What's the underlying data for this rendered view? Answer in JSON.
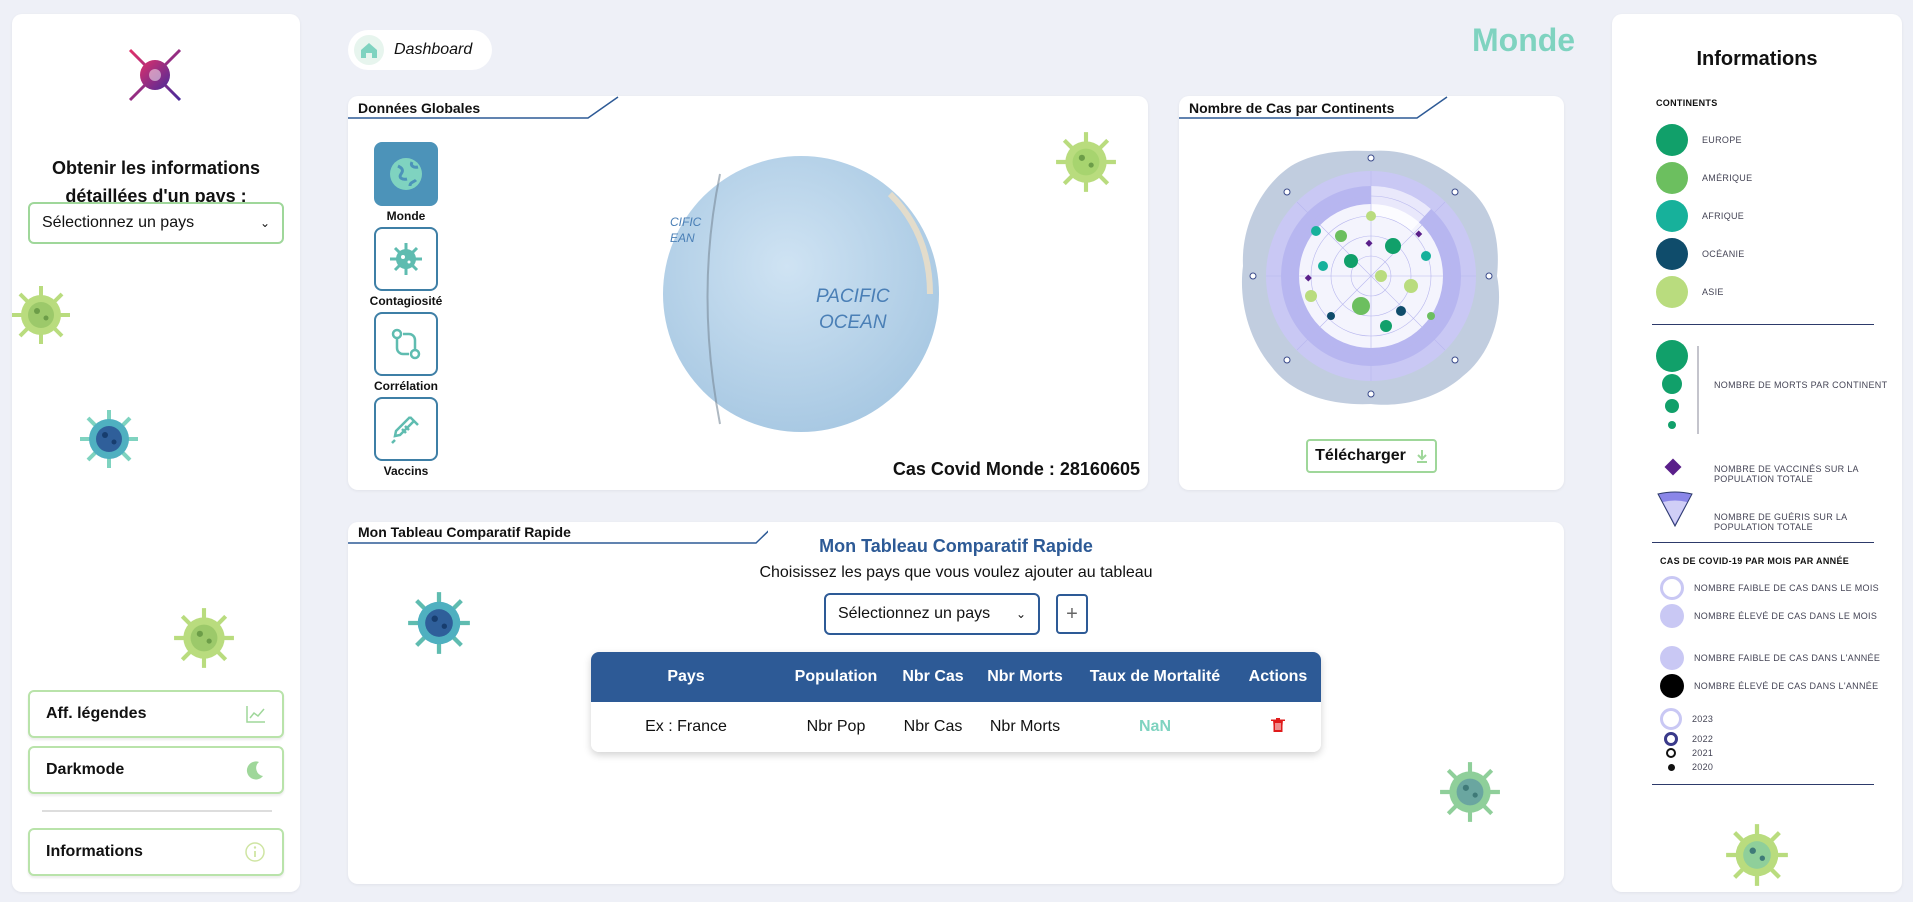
{
  "sidebar": {
    "prompt_line1": "Obtenir les informations",
    "prompt_line2": "détaillées d'un pays :",
    "country_select": "Sélectionnez un pays",
    "buttons": [
      {
        "label": "Aff. légendes",
        "icon": "chart-line-icon"
      },
      {
        "label": "Darkmode",
        "icon": "moon-icon"
      },
      {
        "label": "Informations",
        "icon": "info-circle-icon"
      }
    ]
  },
  "header": {
    "breadcrumb": "Dashboard",
    "page_title": "Monde"
  },
  "global": {
    "tab": "Données Globales",
    "modes": [
      {
        "label": "Monde",
        "icon": "globe-icon",
        "active": true
      },
      {
        "label": "Contagiosité",
        "icon": "virus-icon",
        "active": false
      },
      {
        "label": "Corrélation",
        "icon": "correlation-icon",
        "active": false
      },
      {
        "label": "Vaccins",
        "icon": "syringe-icon",
        "active": false
      }
    ],
    "globe_label_line1": "PACIFIC",
    "globe_label_line2": "OCEAN",
    "globe_edge_label": "CIFIC\nEAN",
    "cases_label": "Cas Covid Monde : 28160605"
  },
  "continents_chart": {
    "tab": "Nombre de Cas par Continents",
    "download_label": "Télécharger"
  },
  "compare": {
    "tab": "Mon Tableau Comparatif Rapide",
    "title": "Mon Tableau Comparatif Rapide",
    "subtitle": "Choisissez les pays que vous voulez ajouter au tableau",
    "select": "Sélectionnez un pays",
    "add_label": "+",
    "columns": [
      "Pays",
      "Population",
      "Nbr Cas",
      "Nbr Morts",
      "Taux de Mortalité",
      "Actions"
    ],
    "row": [
      "Ex : France",
      "Nbr Pop",
      "Nbr Cas",
      "Nbr Morts",
      "NaN"
    ]
  },
  "info": {
    "title": "Informations",
    "continents_title": "CONTINENTS",
    "continents": [
      {
        "name": "EUROPE",
        "color": "#11a06a"
      },
      {
        "name": "AMÉRIQUE",
        "color": "#6cbf5f"
      },
      {
        "name": "AFRIQUE",
        "color": "#17b19b"
      },
      {
        "name": "OCÉANIE",
        "color": "#0f4c6b"
      },
      {
        "name": "ASIE",
        "color": "#b9dc7e"
      }
    ],
    "deaths_label": "NOMBRE DE MORTS PAR CONTINENT",
    "vaccinated_label": "NOMBRE DE VACCINÉS SUR LA POPULATION TOTALE",
    "recovered_label": "NOMBRE DE GUÉRIS SUR LA POPULATION TOTALE",
    "monthly_title": "CAS DE COVID-19 PAR MOIS PAR ANNÉE",
    "monthly": [
      "NOMBRE FAIBLE DE CAS DANS LE MOIS",
      "NOMBRE ÉLEVÉ DE CAS DANS LE MOIS",
      "NOMBRE FAIBLE DE CAS DANS L'ANNÉE",
      "NOMBRE ÉLEVÉ DE CAS DANS L'ANNÉE"
    ],
    "years": [
      "2023",
      "2022",
      "2021",
      "2020"
    ]
  }
}
